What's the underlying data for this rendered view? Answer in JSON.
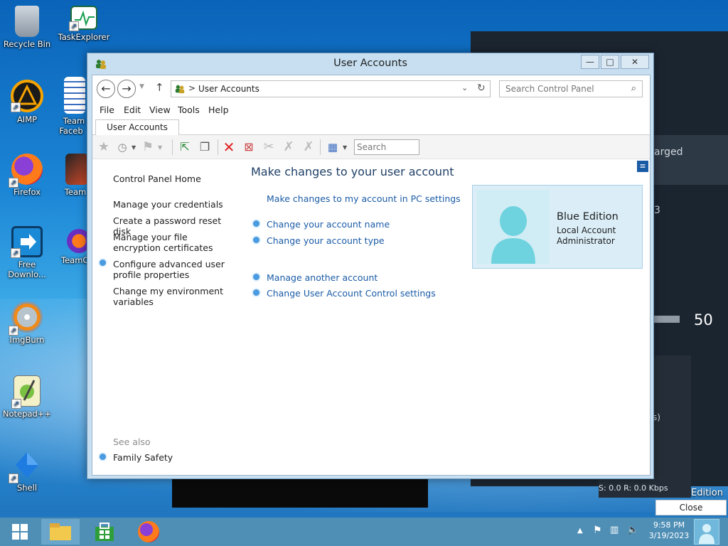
{
  "desktop": {
    "icons": [
      {
        "label": "Recycle Bin"
      },
      {
        "label": "TaskExplorer"
      },
      {
        "label": "AIMP"
      },
      {
        "label": "Team Faceb"
      },
      {
        "label": "Firefox"
      },
      {
        "label": "Team"
      },
      {
        "label": "Free Downlo..."
      },
      {
        "label": "TeamO"
      },
      {
        "label": "ImgBurn"
      },
      {
        "label": "Notepad++"
      },
      {
        "label": "Shell"
      }
    ],
    "bg_widget": {
      "text_charged": "arged",
      "text_3": "3",
      "volume_value": "50",
      "text_s": "s)",
      "net_label": "S: 0.0  R: 0.0 Kbps",
      "edition": "Edition"
    }
  },
  "window": {
    "title": "User Accounts",
    "controls": {
      "minimize": "—",
      "maximize": "□",
      "close": "✕"
    },
    "address": {
      "separator": ">",
      "path": "User Accounts"
    },
    "search_placeholder": "Search Control Panel",
    "menu": [
      "File",
      "Edit",
      "View",
      "Tools",
      "Help"
    ],
    "tab_label": "User Accounts",
    "toolbar_search_placeholder": "Search",
    "left_nav": {
      "home": "Control Panel Home",
      "items": [
        "Manage your credentials",
        "Create a password reset disk",
        "Manage your file encryption certificates",
        "Configure advanced user profile properties",
        "Change my environment variables"
      ],
      "see_also_label": "See also",
      "see_also_items": [
        "Family Safety"
      ]
    },
    "main": {
      "heading": "Make changes to your user account",
      "pc_settings_link": "Make changes to my account in PC settings",
      "links_group1": [
        "Change your account name",
        "Change your account type"
      ],
      "links_group2": [
        "Manage another account",
        "Change User Account Control settings"
      ]
    },
    "user": {
      "name": "Blue Edition",
      "type": "Local Account",
      "role": "Administrator"
    }
  },
  "taskbar": {
    "clock_time": "9:58 PM",
    "clock_date": "3/19/2023",
    "popup_close": "Close"
  },
  "colors": {
    "link": "#1a5ba6",
    "heading": "#1e3f66",
    "taskbar": "#4f8fb6",
    "window_frame": "#c7dff0"
  }
}
